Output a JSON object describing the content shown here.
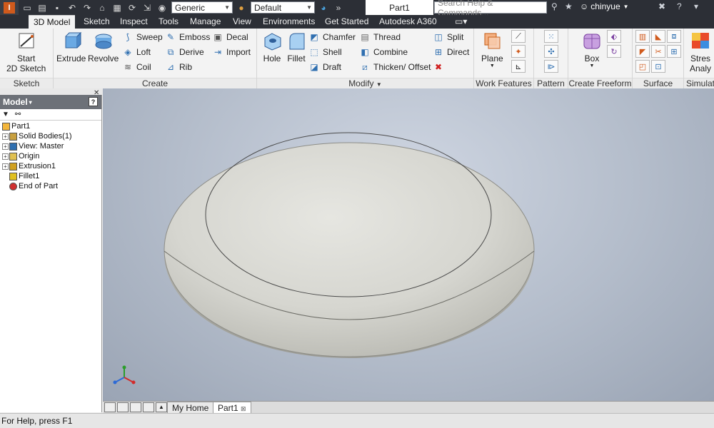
{
  "qat": {
    "appearance_select": "Generic",
    "material_select": "Default",
    "doc_title": "Part1",
    "search_placeholder": "Search Help & Commands...",
    "username": "chinyue"
  },
  "tabs": [
    "3D Model",
    "Sketch",
    "Inspect",
    "Tools",
    "Manage",
    "View",
    "Environments",
    "Get Started",
    "Autodesk A360"
  ],
  "ribbon": {
    "sketch": {
      "title": "Sketch",
      "start_line1": "Start",
      "start_line2": "2D Sketch"
    },
    "create": {
      "title": "Create",
      "extrude": "Extrude",
      "revolve": "Revolve",
      "sweep": "Sweep",
      "loft": "Loft",
      "coil": "Coil",
      "emboss": "Emboss",
      "derive": "Derive",
      "rib": "Rib",
      "decal": "Decal",
      "import": "Import"
    },
    "modify": {
      "title": "Modify",
      "hole": "Hole",
      "fillet": "Fillet",
      "chamfer": "Chamfer",
      "shell": "Shell",
      "draft": "Draft",
      "thread": "Thread",
      "combine": "Combine",
      "thicken": "Thicken/ Offset",
      "split": "Split",
      "direct": "Direct"
    },
    "work_features": {
      "title": "Work Features",
      "plane": "Plane"
    },
    "pattern": {
      "title": "Pattern"
    },
    "freeform": {
      "title": "Create Freeform",
      "box": "Box"
    },
    "surface": {
      "title": "Surface"
    },
    "simulation": {
      "title": "Simulat",
      "stress_line1": "Stres",
      "stress_line2": "Analy"
    }
  },
  "browser": {
    "title": "Model",
    "tree": [
      {
        "label": "Part1",
        "expandable": false,
        "indent": 0
      },
      {
        "label": "Solid Bodies(1)",
        "expandable": true,
        "indent": 1
      },
      {
        "label": "View: Master",
        "expandable": true,
        "indent": 1
      },
      {
        "label": "Origin",
        "expandable": true,
        "indent": 1
      },
      {
        "label": "Extrusion1",
        "expandable": true,
        "indent": 1
      },
      {
        "label": "Fillet1",
        "expandable": false,
        "indent": 1
      },
      {
        "label": "End of Part",
        "expandable": false,
        "indent": 1
      }
    ]
  },
  "doc_tabs": {
    "home": "My Home",
    "part": "Part1"
  },
  "status": {
    "text": "For Help, press F1"
  },
  "colors": {
    "accent": "#d05a1c",
    "viewport_bg": "#b3bcca",
    "part_face": "#d6d6d0"
  }
}
